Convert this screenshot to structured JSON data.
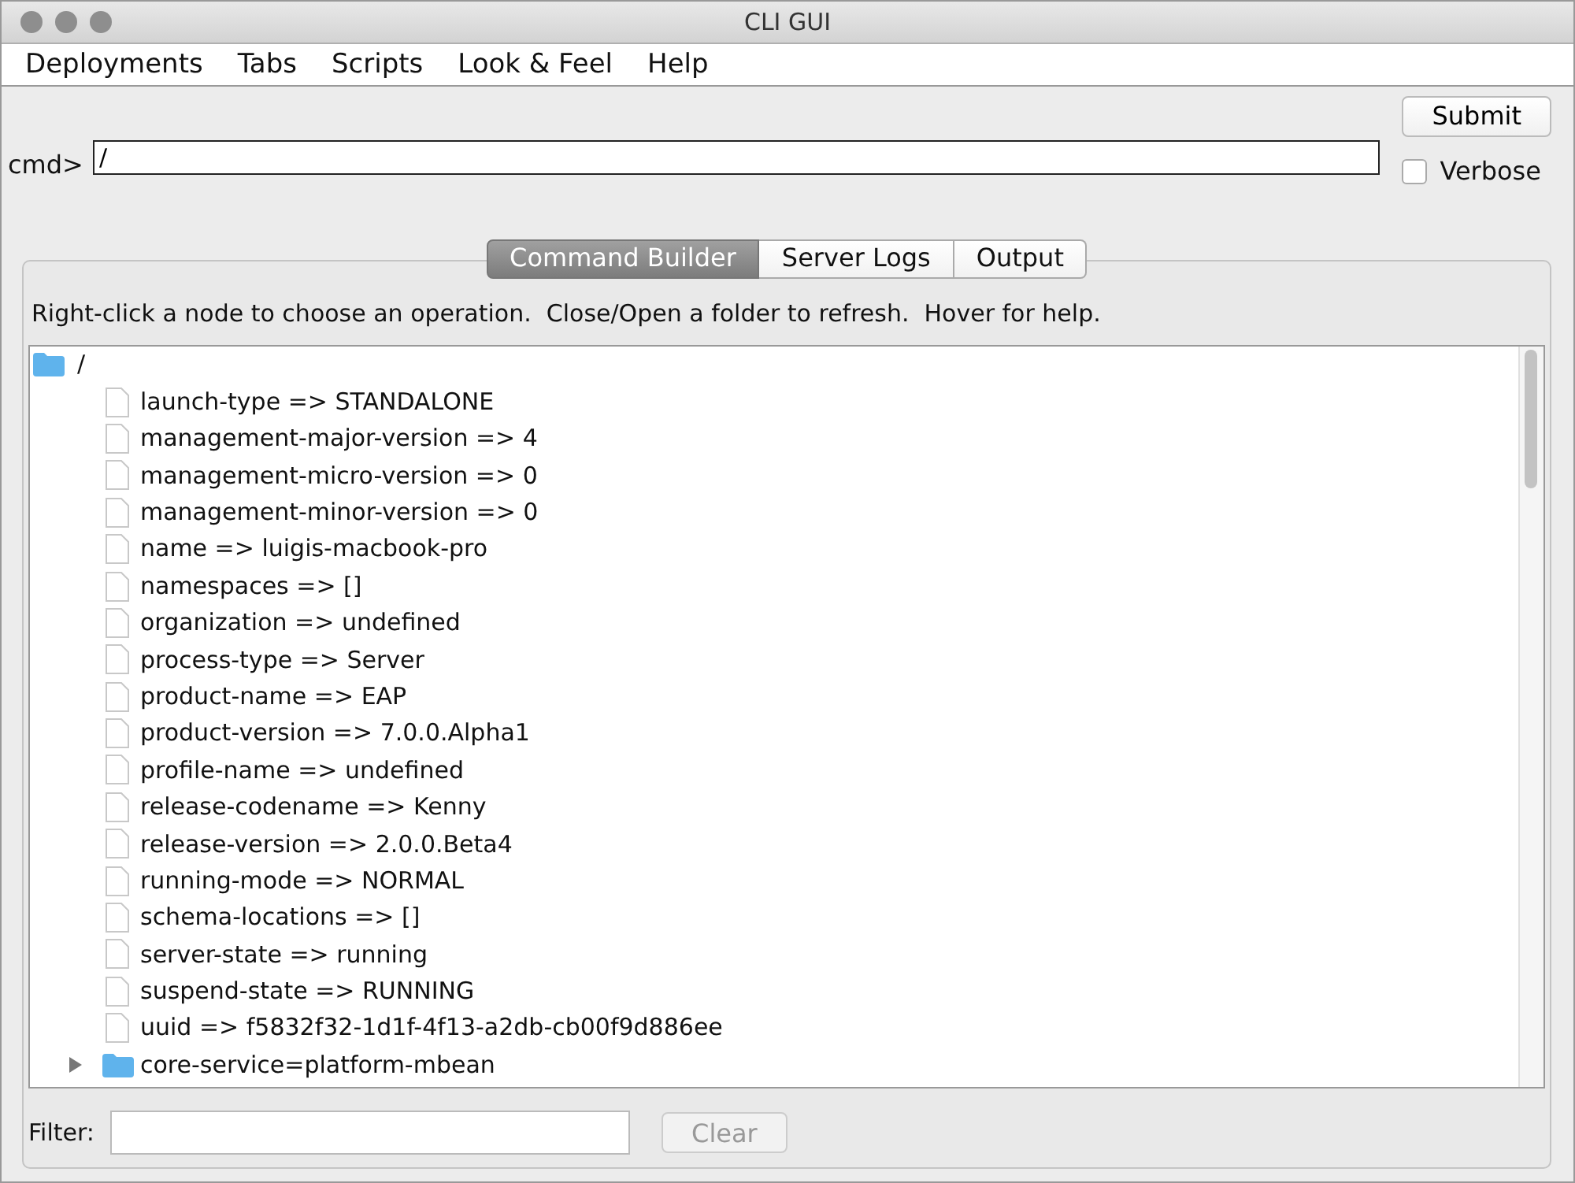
{
  "window": {
    "title": "CLI GUI"
  },
  "menu": [
    "Deployments",
    "Tabs",
    "Scripts",
    "Look & Feel",
    "Help"
  ],
  "command": {
    "label": "cmd>",
    "value": "/"
  },
  "submit": "Submit",
  "verbose": {
    "label": "Verbose",
    "checked": false
  },
  "tabs": [
    {
      "label": "Command Builder",
      "selected": true
    },
    {
      "label": "Server Logs",
      "selected": false
    },
    {
      "label": "Output",
      "selected": false
    }
  ],
  "hint": "Right-click a node to choose an operation.  Close/Open a folder to refresh.  Hover for help.",
  "tree": [
    {
      "label": "/",
      "kind": "folder",
      "children": [
        {
          "label": "launch-type => STANDALONE",
          "kind": "leaf"
        },
        {
          "label": "management-major-version => 4",
          "kind": "leaf"
        },
        {
          "label": "management-micro-version => 0",
          "kind": "leaf"
        },
        {
          "label": "management-minor-version => 0",
          "kind": "leaf"
        },
        {
          "label": "name => luigis-macbook-pro",
          "kind": "leaf"
        },
        {
          "label": "namespaces => []",
          "kind": "leaf"
        },
        {
          "label": "organization => undefined",
          "kind": "leaf"
        },
        {
          "label": "process-type => Server",
          "kind": "leaf"
        },
        {
          "label": "product-name => EAP",
          "kind": "leaf"
        },
        {
          "label": "product-version => 7.0.0.Alpha1",
          "kind": "leaf"
        },
        {
          "label": "profile-name => undefined",
          "kind": "leaf"
        },
        {
          "label": "release-codename => Kenny",
          "kind": "leaf"
        },
        {
          "label": "release-version => 2.0.0.Beta4",
          "kind": "leaf"
        },
        {
          "label": "running-mode => NORMAL",
          "kind": "leaf"
        },
        {
          "label": "schema-locations => []",
          "kind": "leaf"
        },
        {
          "label": "server-state => running",
          "kind": "leaf"
        },
        {
          "label": "suspend-state => RUNNING",
          "kind": "leaf"
        },
        {
          "label": "uuid => f5832f32-1d1f-4f13-a2db-cb00f9d886ee",
          "kind": "leaf"
        },
        {
          "label": "core-service=platform-mbean",
          "kind": "folder",
          "expanded": false
        }
      ]
    }
  ],
  "filter": {
    "label": "Filter:"
  },
  "clear": {
    "label": "Clear",
    "disabled": true
  }
}
